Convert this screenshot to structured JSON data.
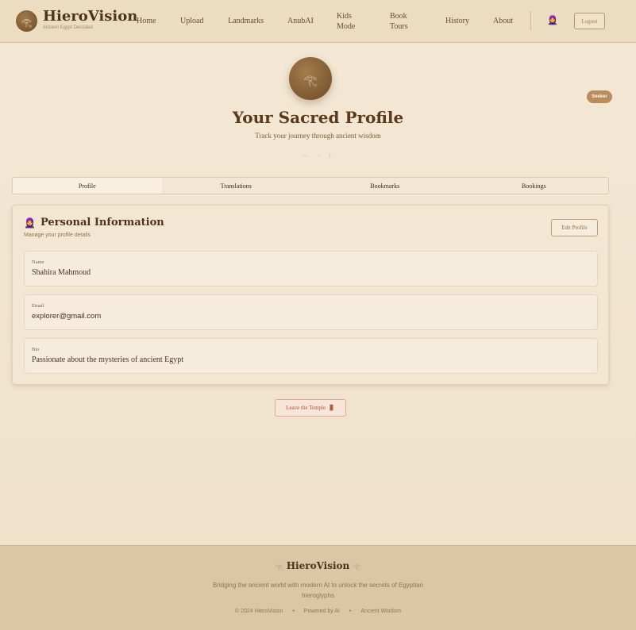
{
  "brand": {
    "logo_icon": "eye-of-horus-icon",
    "logo_glyph": "𓂀",
    "name": "HieroVision",
    "tagline": "Ancient Egypt Decoded"
  },
  "nav": {
    "items": [
      {
        "label": "Home"
      },
      {
        "label": "Upload"
      },
      {
        "label": "Landmarks"
      },
      {
        "label": "AnubAI"
      },
      {
        "label": "Kids Mode"
      },
      {
        "label": "Book Tours"
      },
      {
        "label": "History"
      },
      {
        "label": "About"
      }
    ],
    "user_icon_glyph": "🧕",
    "logout_label": "Logout"
  },
  "hero": {
    "avatar_glyph": "𓂀",
    "badge": "Seeker",
    "title": "Your Sacred Profile",
    "subtitle": "Track your journey through ancient wisdom",
    "ornament": "— ◦ /"
  },
  "tabs": [
    {
      "label": "Profile",
      "active": true
    },
    {
      "label": "Translations",
      "active": false
    },
    {
      "label": "Bookmarks",
      "active": false
    },
    {
      "label": "Bookings",
      "active": false
    }
  ],
  "card": {
    "icon_glyph": "🧕",
    "title": "Personal Information",
    "subtitle": "Manage your profile details",
    "edit_label": "Edit Profile",
    "fields": [
      {
        "label": "Name",
        "value": "Shahira Mahmoud"
      },
      {
        "label": "Email",
        "value": "explorer@gmail.com"
      },
      {
        "label": "Bio",
        "value": "Passionate about the mysteries of ancient Egypt"
      }
    ]
  },
  "leave": {
    "label": "Leave the Temple",
    "icon_glyph": "🚪"
  },
  "footer": {
    "deco_left": "𓂀",
    "title": "HieroVision",
    "deco_right": "𓂀",
    "description": "Bridging the ancient world with modern AI to unlock the secrets of Egyptian hieroglyphs",
    "copyright": "© 2024 HieroVision",
    "powered": "Powered by AI",
    "wisdom": "Ancient Wisdom"
  },
  "colors": {
    "accent": "#b98d5b",
    "brand_dark": "#4e3319",
    "danger": "#b4483c"
  }
}
